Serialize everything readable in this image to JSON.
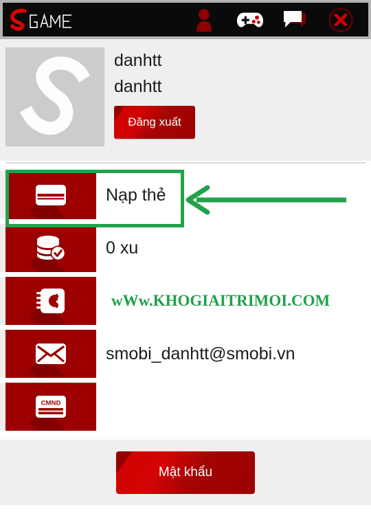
{
  "header": {
    "brand": "SGAME",
    "brand_initial": "S",
    "brand_rest": "GAME",
    "icons": [
      {
        "name": "person-icon",
        "label": "Tài khoản"
      },
      {
        "name": "gamepad-icon",
        "label": "Trò chơi"
      },
      {
        "name": "chat-bubble-icon",
        "label": "Tin nhắn"
      },
      {
        "name": "close-circle-icon",
        "label": "Đóng"
      }
    ]
  },
  "profile": {
    "avatar_alt": "S",
    "display_name": "danhtt",
    "username": "danhtt",
    "logout_label": "Đăng xuất"
  },
  "rows": [
    {
      "icon": "credit-card-icon",
      "label": "Nạp thẻ",
      "highlighted": true,
      "promo": false
    },
    {
      "icon": "coins-check-icon",
      "label": "0 xu",
      "highlighted": false,
      "promo": false
    },
    {
      "icon": "address-book-icon",
      "label": "wWw.KHOGIAITRIMOI.COM",
      "highlighted": false,
      "promo": true
    },
    {
      "icon": "envelope-icon",
      "label": "smobi_danhtt@smobi.vn",
      "highlighted": false,
      "promo": false
    },
    {
      "icon": "id-card-icon",
      "label": "",
      "highlighted": false,
      "promo": false
    }
  ],
  "icon_text": {
    "id_card_caption": "CMND"
  },
  "footer": {
    "password_label": "Mật khẩu"
  },
  "annotation": {
    "arrow_color": "#22a24c",
    "box_color": "#22a24c",
    "target": "Nạp thẻ"
  },
  "colors": {
    "header_bg": "#0a0a0a",
    "header_border": "#b3b3b3",
    "page_bg": "#efefef",
    "row_bg": "#ffffff",
    "icon_bg": "#9c0000",
    "button_red": "#d20202",
    "brand_red": "#e00000",
    "promo_green": "#21a04a",
    "text": "#1b1b1b"
  }
}
